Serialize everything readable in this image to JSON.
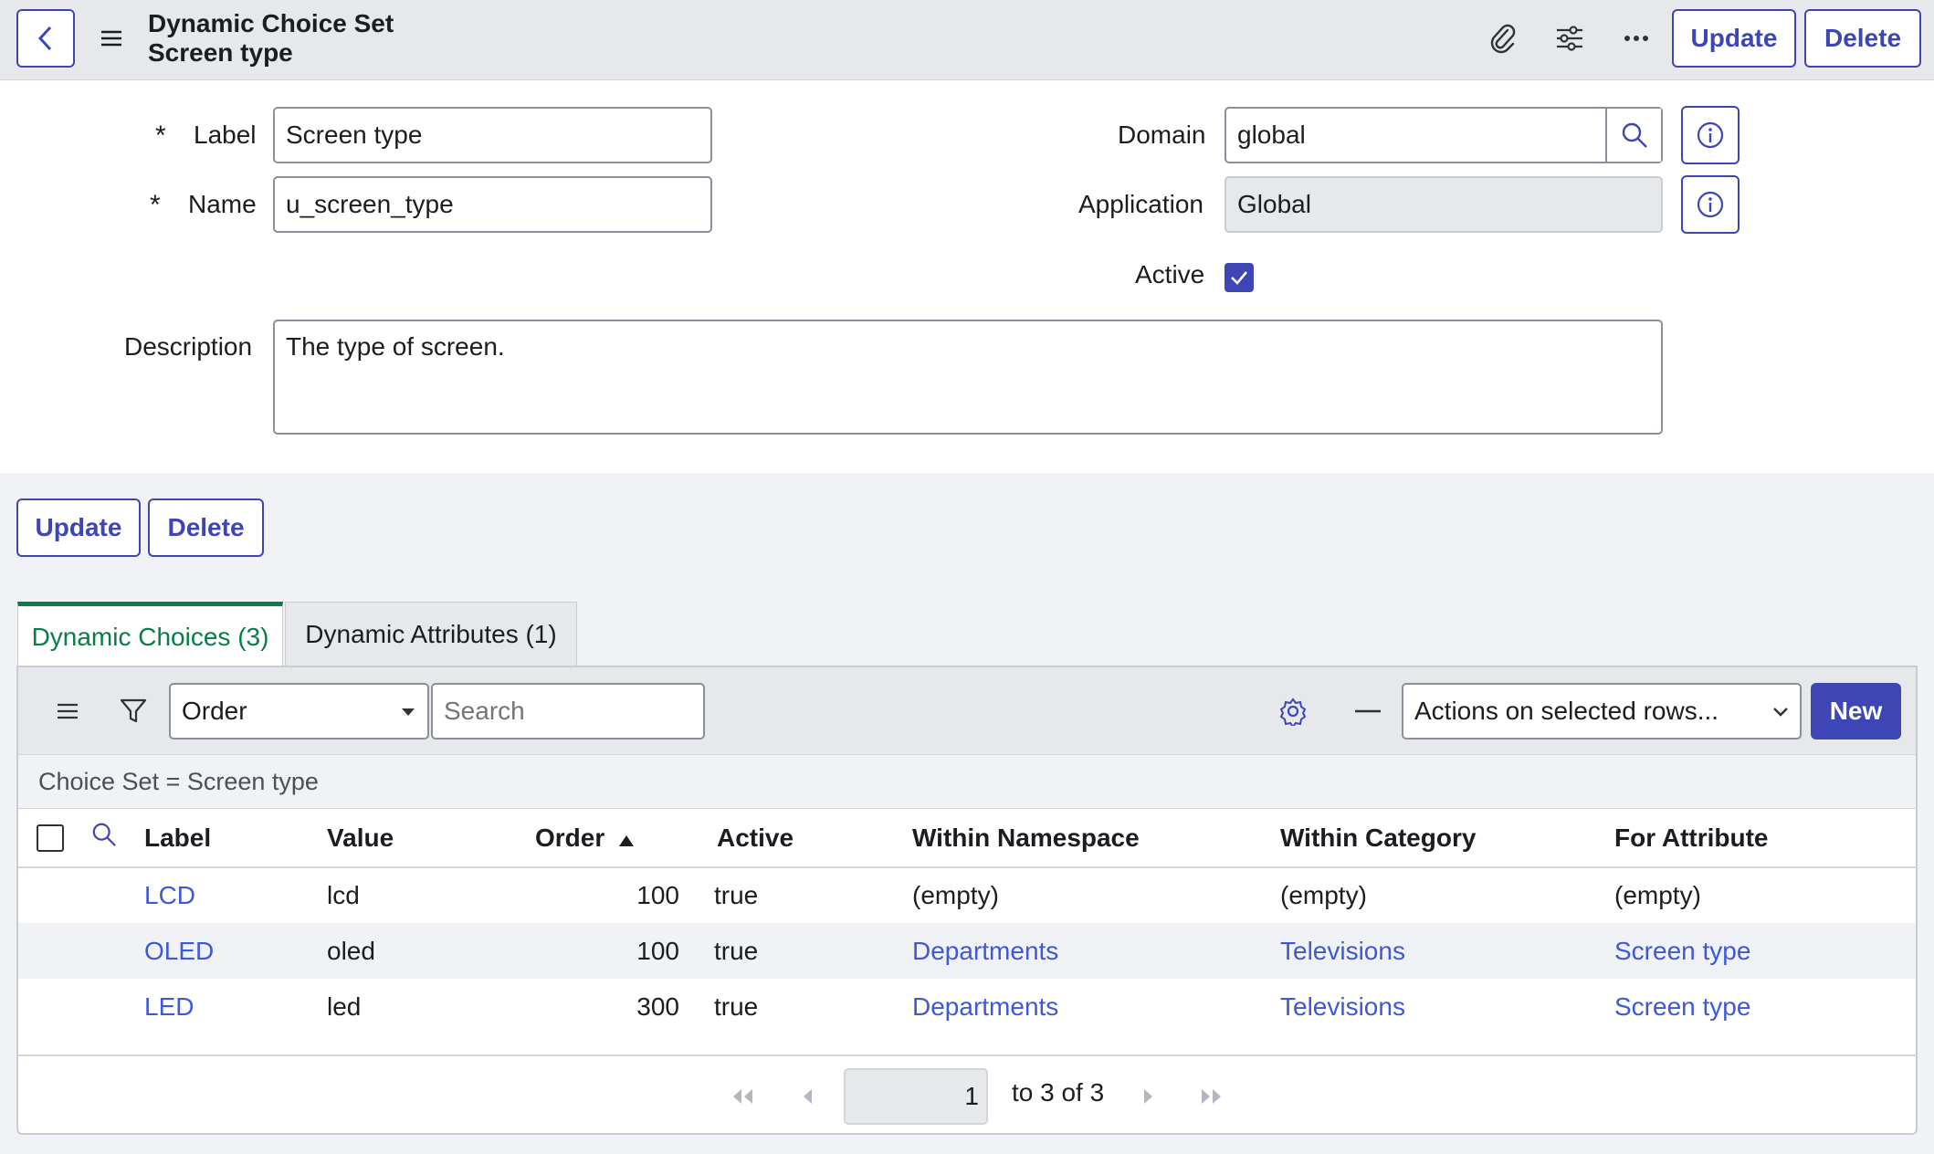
{
  "header": {
    "title_line1": "Dynamic Choice Set",
    "title_line2": "Screen type",
    "update_label": "Update",
    "delete_label": "Delete"
  },
  "form": {
    "label_label": "Label",
    "label_value": "Screen type",
    "name_label": "Name",
    "name_value": "u_screen_type",
    "domain_label": "Domain",
    "domain_value": "global",
    "application_label": "Application",
    "application_value": "Global",
    "active_label": "Active",
    "active_checked": true,
    "description_label": "Description",
    "description_value": "The type of screen.",
    "required_mark": "*"
  },
  "form_actions": {
    "update_label": "Update",
    "delete_label": "Delete"
  },
  "tabs": [
    {
      "label": "Dynamic Choices (3)",
      "active": true
    },
    {
      "label": "Dynamic Attributes (1)",
      "active": false
    }
  ],
  "list_toolbar": {
    "field_select": "Order",
    "search_placeholder": "Search",
    "actions_select": "Actions on selected rows...",
    "new_label": "New"
  },
  "filter_breadcrumb": "Choice Set = Screen type",
  "table": {
    "columns": [
      "Label",
      "Value",
      "Order",
      "Active",
      "Within Namespace",
      "Within Category",
      "For Attribute"
    ],
    "sort_column": "Order",
    "sort_dir": "asc",
    "rows": [
      {
        "label": "LCD",
        "value": "lcd",
        "order": "100",
        "active": "true",
        "namespace": "(empty)",
        "category": "(empty)",
        "attribute": "(empty)"
      },
      {
        "label": "OLED",
        "value": "oled",
        "order": "100",
        "active": "true",
        "namespace": "Departments",
        "category": "Televisions",
        "attribute": "Screen type"
      },
      {
        "label": "LED",
        "value": "led",
        "order": "300",
        "active": "true",
        "namespace": "Departments",
        "category": "Televisions",
        "attribute": "Screen type"
      }
    ]
  },
  "pager": {
    "current": "1",
    "range_text": "to 3 of 3"
  },
  "colors": {
    "accent": "#3e46b5",
    "tab_active": "#0a7d46",
    "link": "#3e58d6"
  }
}
